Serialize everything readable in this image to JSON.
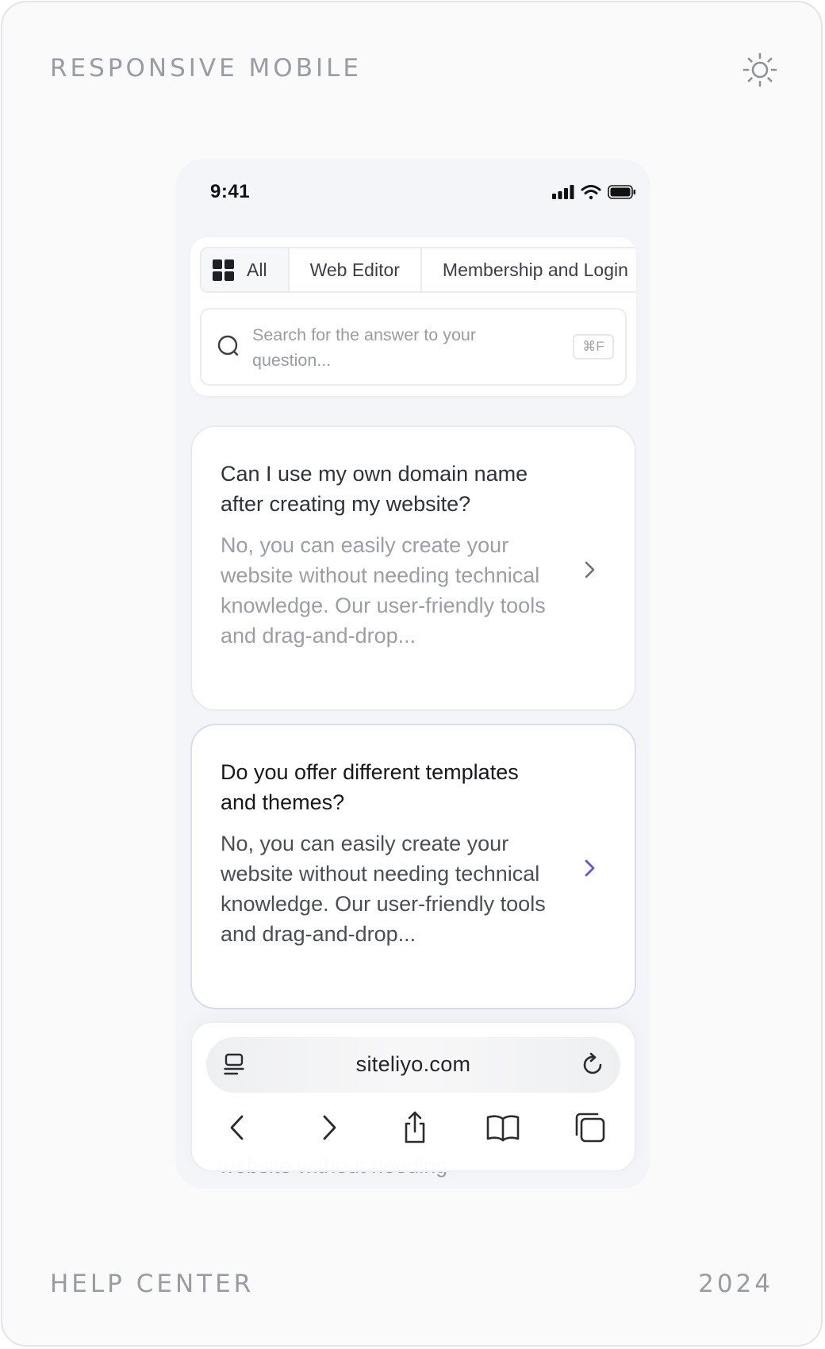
{
  "labels": {
    "top_left": "RESPONSIVE MOBILE",
    "bottom_left": "HELP CENTER",
    "bottom_right": "2024"
  },
  "icons": {
    "theme_toggle": "sun-icon",
    "signal": "cellular-signal-icon",
    "wifi": "wifi-icon",
    "battery": "battery-icon",
    "search": "search-icon",
    "chevron": "chevron-right-icon",
    "reader": "reader-mode-icon",
    "reload": "reload-icon",
    "back": "chevron-left-icon",
    "forward": "chevron-right-icon",
    "share": "share-icon",
    "bookmarks": "book-icon",
    "tabs": "tabs-icon"
  },
  "status_bar": {
    "time": "9:41"
  },
  "tabs": [
    {
      "label": "All",
      "icon": "grid-icon",
      "active": true
    },
    {
      "label": "Web Editor",
      "active": false
    },
    {
      "label": "Membership and Login",
      "active": false
    }
  ],
  "search": {
    "placeholder": "Search for the answer to your question...",
    "shortcut": "⌘F"
  },
  "faq": [
    {
      "question": "Can I use my own domain name after creating my website?",
      "answer": "No, you can easily create your website without needing technical knowledge. Our user-friendly tools and drag-and-drop...",
      "highlighted": false
    },
    {
      "question": "Do you offer different templates and themes?",
      "answer": "No, you can easily create your website without needing technical knowledge. Our user-friendly tools and drag-and-drop...",
      "highlighted": true
    }
  ],
  "partial_card_text": "website without needing",
  "browser": {
    "url": "siteliyo.com"
  },
  "colors": {
    "accent": "#5b5bd6",
    "muted_text": "#9b9ea6",
    "border": "#e9eaee"
  }
}
